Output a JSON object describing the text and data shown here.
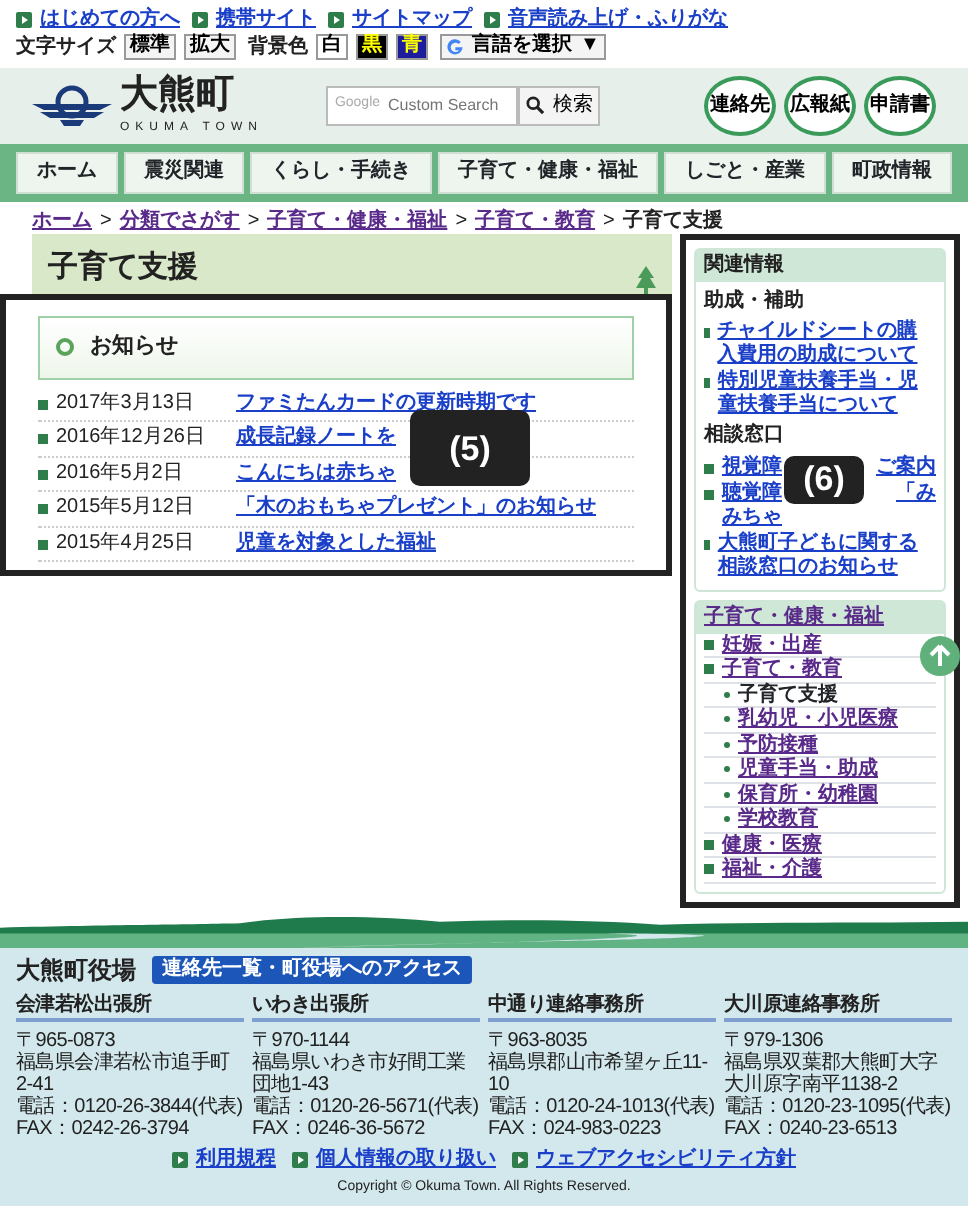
{
  "top_links": [
    "はじめての方へ",
    "携帯サイト",
    "サイトマップ",
    "音声読み上げ・ふりがな"
  ],
  "text_size": {
    "label": "文字サイズ",
    "buttons": [
      "標準",
      "拡大"
    ]
  },
  "background_color": {
    "label": "背景色",
    "buttons": [
      {
        "label": "白",
        "color": "#ffffff"
      },
      {
        "label": "黒",
        "color": "#000000"
      },
      {
        "label": "青",
        "color": "#1c1c9c"
      }
    ]
  },
  "translate": {
    "label": "言語を選択",
    "caret": "▼"
  },
  "logo": {
    "name": "大熊町",
    "subtitle": "OKUMA TOWN"
  },
  "search": {
    "brand": "Google",
    "placeholder": "Custom Search",
    "button": "検索"
  },
  "quick_buttons": [
    "連絡先",
    "広報紙",
    "申請書"
  ],
  "nav": [
    "ホーム",
    "震災関連",
    "くらし・手続き",
    "子育て・健康・福祉",
    "しごと・産業",
    "町政情報"
  ],
  "breadcrumb": {
    "separator": ">",
    "items": [
      {
        "label": "ホーム",
        "link": true
      },
      {
        "label": "分類でさがす",
        "link": true
      },
      {
        "label": "子育て・健康・福祉",
        "link": true
      },
      {
        "label": "子育て・教育",
        "link": true
      },
      {
        "label": "子育て支援",
        "link": false
      }
    ]
  },
  "page_title": "子育て支援",
  "notices": {
    "title": "お知らせ",
    "annotation": "(5)",
    "items": [
      {
        "date": "2017年3月13日",
        "title": "ファミたんカードの更新時期です"
      },
      {
        "date": "2016年12月26日",
        "title": "成長記録ノートを"
      },
      {
        "date": "2016年5月2日",
        "title": "こんにちは赤ちゃ"
      },
      {
        "date": "2015年5月12日",
        "title": "「木のおもちゃプレゼント」のお知らせ"
      },
      {
        "date": "2015年4月25日",
        "title": "児童を対象とした福祉"
      }
    ]
  },
  "related": {
    "title": "関連情報",
    "annotation": "(6)",
    "groups": [
      {
        "heading": "助成・補助",
        "items": [
          {
            "text": "チャイルドシートの購入費用の助成について"
          },
          {
            "text": "特別児童扶養手当・児童扶養手当について"
          }
        ]
      },
      {
        "heading": "相談窓口",
        "items": [
          {
            "text": "視覚障",
            "tail": "ご案内"
          },
          {
            "text": "聴覚障",
            "tail": "「み",
            "line2": "みちゃ"
          },
          {
            "text": "大熊町子どもに関する相談窓口のお知らせ"
          }
        ]
      }
    ]
  },
  "category_menu": {
    "title": "子育て・健康・福祉",
    "items": [
      {
        "label": "妊娠・出産",
        "selected": false
      },
      {
        "label": "子育て・教育",
        "selected": false,
        "children": [
          {
            "label": "子育て支援",
            "selected": true
          },
          {
            "label": "乳幼児・小児医療",
            "selected": false
          },
          {
            "label": "予防接種",
            "selected": false
          },
          {
            "label": "児童手当・助成",
            "selected": false
          },
          {
            "label": "保育所・幼稚園",
            "selected": false
          },
          {
            "label": "学校教育",
            "selected": false
          }
        ]
      },
      {
        "label": "健康・医療",
        "selected": false
      },
      {
        "label": "福祉・介護",
        "selected": false
      }
    ]
  },
  "footer": {
    "title": "大熊町役場",
    "access_button": "連絡先一覧・町役場へのアクセス",
    "offices": [
      {
        "name": "会津若松出張所",
        "lines": [
          "〒965-0873",
          "福島県会津若松市追手町2-41",
          "電話：0120-26-3844(代表)",
          "FAX：0242-26-3794"
        ]
      },
      {
        "name": "いわき出張所",
        "lines": [
          "〒970-1144",
          "福島県いわき市好間工業団地1-43",
          "電話：0120-26-5671(代表)",
          "FAX：0246-36-5672"
        ]
      },
      {
        "name": "中通り連絡事務所",
        "lines": [
          "〒963-8035",
          "福島県郡山市希望ヶ丘11-10",
          "電話：0120-24-1013(代表)",
          "FAX：024-983-0223"
        ]
      },
      {
        "name": "大川原連絡事務所",
        "lines": [
          "〒979-1306",
          "福島県双葉郡大熊町大字大川原字南平1138-2",
          "電話：0120-23-1095(代表)",
          "FAX：0240-23-6513"
        ]
      }
    ],
    "links": [
      "利用規程",
      "個人情報の取り扱い",
      "ウェブアクセシビリティ方針"
    ],
    "copyright": "Copyright © Okuma Town. All Rights Reserved."
  }
}
